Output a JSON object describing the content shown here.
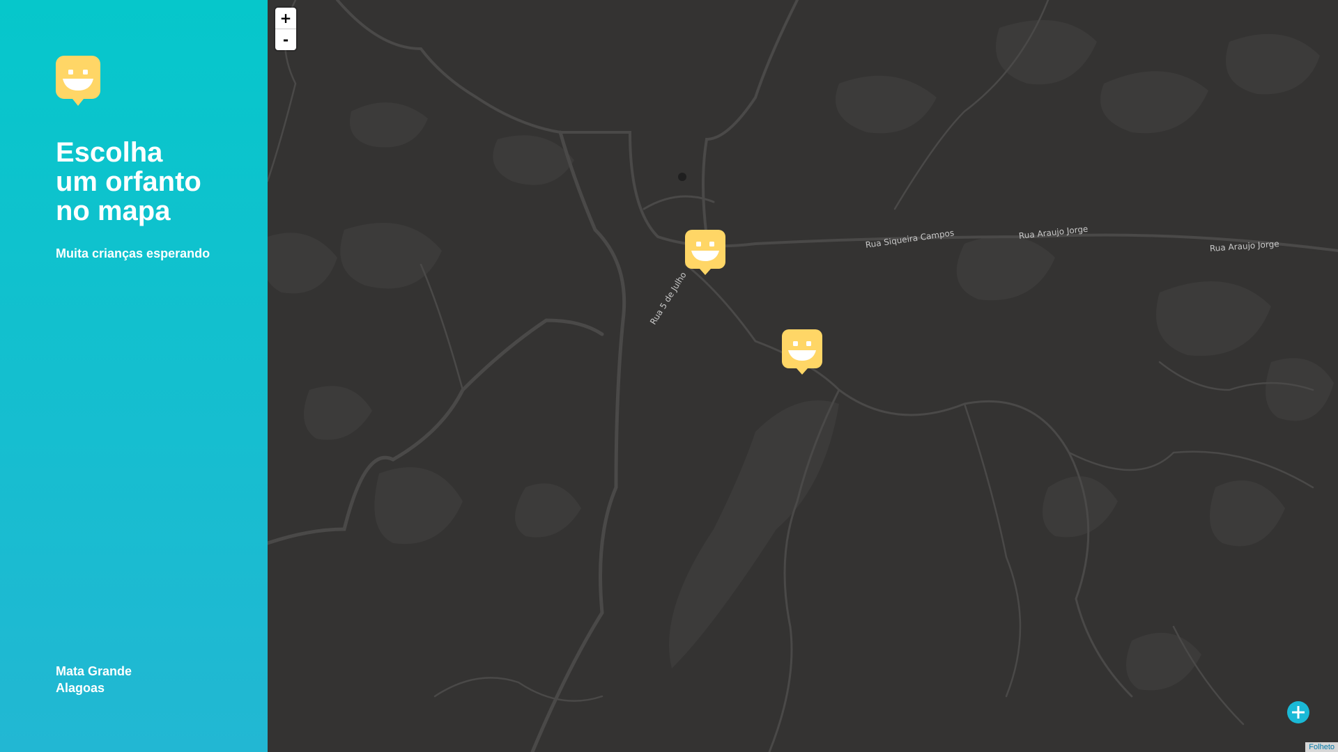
{
  "sidebar": {
    "logo_icon": "smiley-speech-bubble-icon",
    "headline_lines": [
      "Escolha",
      "um orfanto",
      "no mapa"
    ],
    "subtitle": "Muita crianças esperando",
    "location": {
      "city": "Mata Grande",
      "state": "Alagoas"
    },
    "background_colors": [
      "#06c7cb",
      "#22b7d3"
    ]
  },
  "map": {
    "zoom_in_label": "+",
    "zoom_out_label": "-",
    "road_labels": [
      "Rua Siqueira Campos",
      "Rua Araujo Jorge",
      "Rua Araujo Jorge",
      "Rua 5 de Julho"
    ],
    "markers": [
      {
        "icon": "smiley-marker-icon"
      },
      {
        "icon": "smiley-marker-icon"
      }
    ],
    "add_button_icon": "plus-icon",
    "attribution": "Folheto",
    "marker_color": "#ffd666",
    "background_color": "#343332"
  }
}
